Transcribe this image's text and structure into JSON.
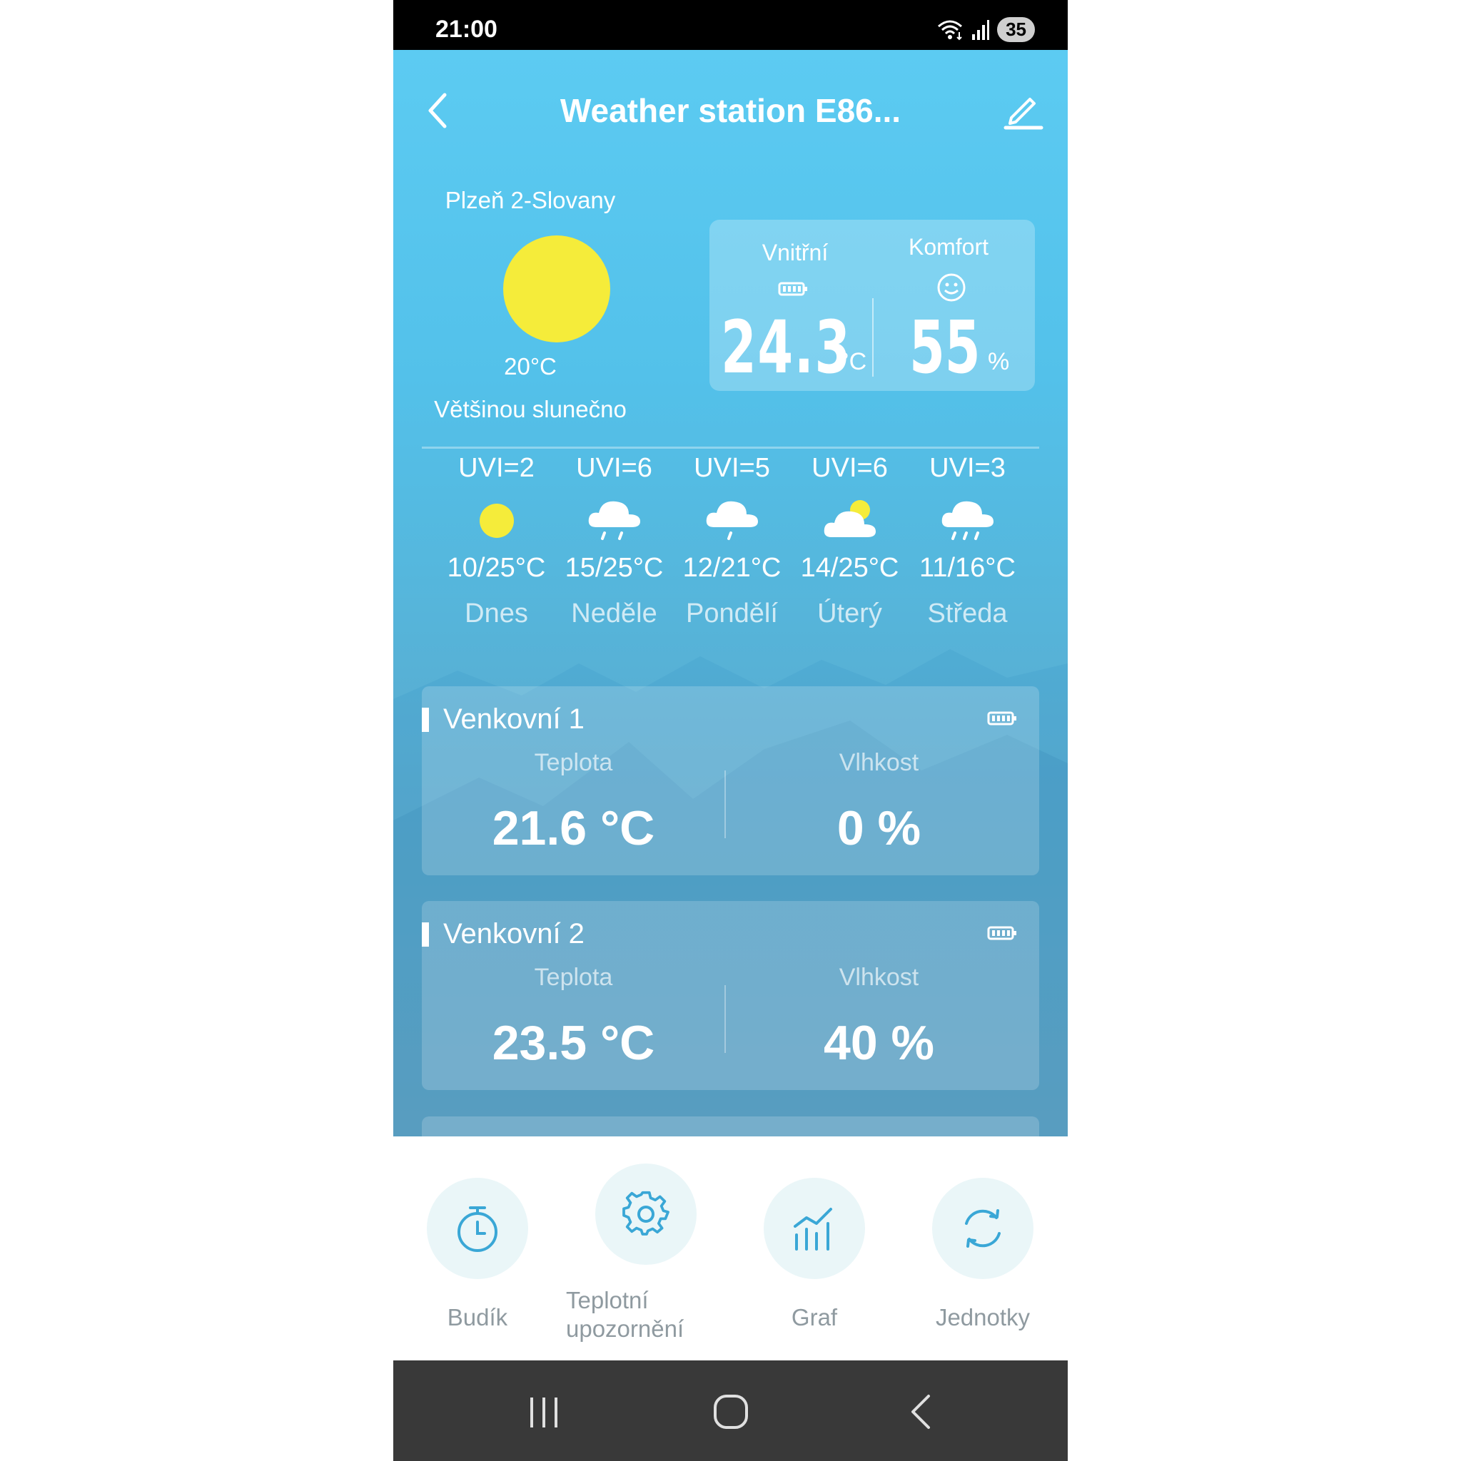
{
  "status_bar": {
    "time": "21:00",
    "battery": "35"
  },
  "header": {
    "title": "Weather station E86..."
  },
  "current": {
    "location": "Plzeň 2-Slovany",
    "temperature": "20°C",
    "condition": "Většinou slunečno",
    "icon": "sun-icon"
  },
  "indoor": {
    "label": "Vnitřní",
    "comfort_label": "Komfort",
    "temperature": "24.3",
    "temperature_unit": "°C",
    "humidity": "55",
    "humidity_unit": "%"
  },
  "forecast": [
    {
      "uvi": "UVI=2",
      "icon": "sun-icon",
      "range": "10/25°C",
      "day": "Dnes"
    },
    {
      "uvi": "UVI=6",
      "icon": "rain-cloud-icon",
      "range": "15/25°C",
      "day": "Neděle"
    },
    {
      "uvi": "UVI=5",
      "icon": "light-rain-cloud-icon",
      "range": "12/21°C",
      "day": "Pondělí"
    },
    {
      "uvi": "UVI=6",
      "icon": "partly-cloudy-icon",
      "range": "14/25°C",
      "day": "Úterý"
    },
    {
      "uvi": "UVI=3",
      "icon": "heavy-rain-cloud-icon",
      "range": "11/16°C",
      "day": "Středa"
    }
  ],
  "sensors": [
    {
      "name": "Venkovní 1",
      "temp_label": "Teplota",
      "temp": "21.6 °C",
      "hum_label": "Vlhkost",
      "hum": "0 %"
    },
    {
      "name": "Venkovní 2",
      "temp_label": "Teplota",
      "temp": "23.5 °C",
      "hum_label": "Vlhkost",
      "hum": "40 %"
    }
  ],
  "actions": [
    {
      "label": "Budík",
      "icon": "stopwatch-icon"
    },
    {
      "label": "Teplotní upozornění",
      "icon": "gear-icon"
    },
    {
      "label": "Graf",
      "icon": "bar-chart-icon"
    },
    {
      "label": "Jednotky",
      "icon": "refresh-icon"
    }
  ],
  "colors": {
    "accent": "#3aa7d6",
    "sun": "#f5ec3a",
    "sky_top": "#5ccbf2"
  }
}
